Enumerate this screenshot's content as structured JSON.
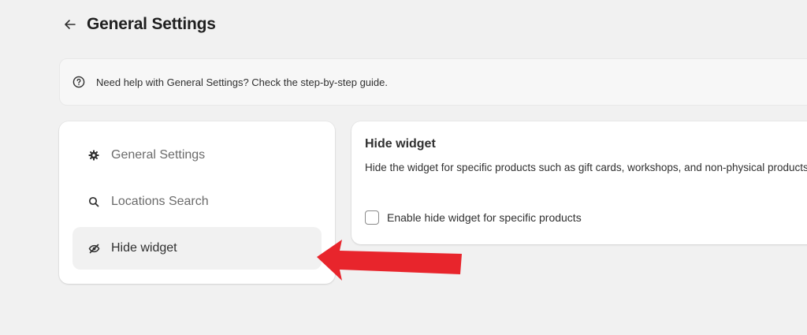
{
  "header": {
    "title": "General Settings",
    "back_icon": "arrow-left-icon"
  },
  "help_banner": {
    "icon": "question-circle-icon",
    "text": "Need help with General Settings? Check the step-by-step guide."
  },
  "sidebar": {
    "items": [
      {
        "label": "General Settings",
        "icon": "gear-icon",
        "active": false
      },
      {
        "label": "Locations Search",
        "icon": "search-icon",
        "active": false
      },
      {
        "label": "Hide widget",
        "icon": "eye-off-icon",
        "active": true
      }
    ]
  },
  "content": {
    "title": "Hide widget",
    "description": "Hide the widget for specific products such as gift cards, workshops, and non-physical products.",
    "checkbox": {
      "label": "Enable hide widget for specific products",
      "checked": false
    }
  },
  "annotation": {
    "arrow_color": "#e8252c"
  }
}
